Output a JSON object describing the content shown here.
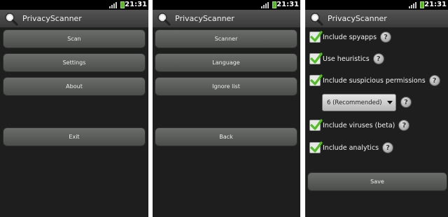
{
  "status": {
    "time": "21:31"
  },
  "app": {
    "title": "PrivacyScanner"
  },
  "main_menu": {
    "scan": "Scan",
    "settings": "Settings",
    "about": "About",
    "exit": "Exit"
  },
  "settings_menu": {
    "scanner": "Scanner",
    "language": "Language",
    "ignore_list": "Ignore list",
    "back": "Back"
  },
  "scanner_settings": {
    "include_spyapps": "Include spyapps",
    "use_heuristics": "Use heuristics",
    "include_suspicious_permissions": "Include suspicious permissions",
    "permission_level": "6 (Recommended)",
    "include_viruses": "Include viruses (beta)",
    "include_analytics": "Include analytics",
    "save": "Save",
    "help_glyph": "?"
  },
  "colors": {
    "check": "#4fbf1f",
    "battery": "#5ab32d"
  },
  "icons": [
    "magnifier-icon",
    "signal-icon",
    "battery-icon",
    "checkmark-icon",
    "help-icon",
    "dropdown-caret-icon"
  ]
}
